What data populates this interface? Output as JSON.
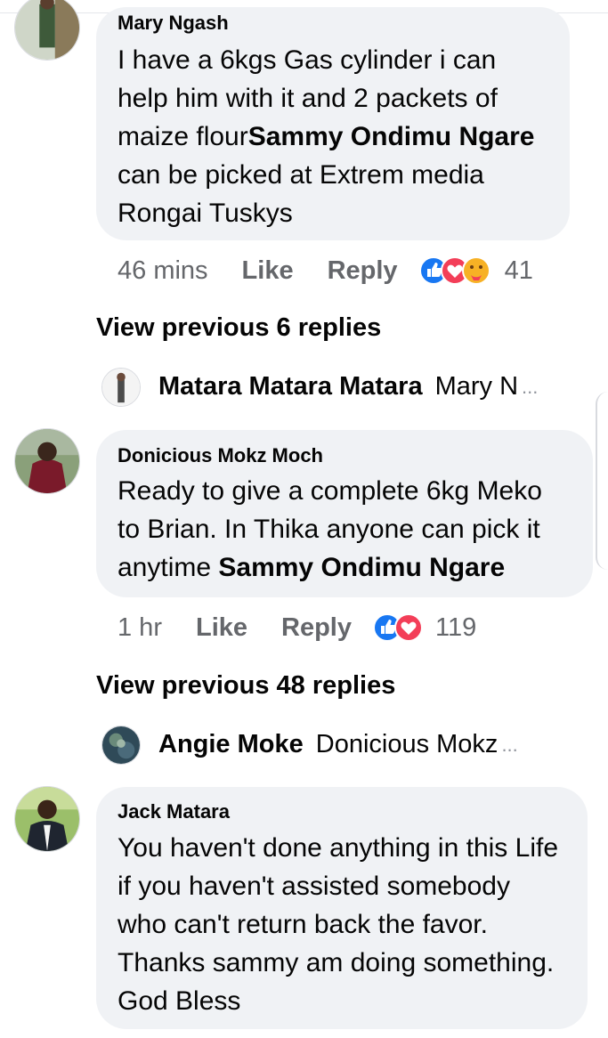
{
  "comments": [
    {
      "author": "Mary Ngash",
      "text_before": "I have a 6kgs Gas cylinder i can help him with it and 2 packets of maize flour",
      "mention": "Sammy Ondimu Ngare",
      "text_after": " can be picked at Extrem media Rongai Tuskys",
      "time": "46 mins",
      "like_label": "Like",
      "reply_label": "Reply",
      "reaction_icons": [
        "like-reaction",
        "love-reaction",
        "care-reaction"
      ],
      "reaction_count": "41"
    },
    {
      "author": "Donicious Mokz Moch",
      "text_before": "Ready to give  a complete 6kg Meko to Brian. In Thika anyone can pick it anytime ",
      "mention": "Sammy Ondimu Ngare",
      "text_after": "",
      "time": "1 hr",
      "like_label": "Like",
      "reply_label": "Reply",
      "reaction_icons": [
        "like-reaction",
        "love-reaction"
      ],
      "reaction_count": "119"
    },
    {
      "author": "Jack Matara",
      "text_before": "You haven't done anything in this Life if you haven't assisted somebody who can't return back the favor. Thanks sammy am doing something. God Bless",
      "mention": "",
      "text_after": ""
    }
  ],
  "view_previous": [
    {
      "label": "View previous 6 replies"
    },
    {
      "label": "View previous 48 replies"
    }
  ],
  "reply_previews": [
    {
      "name": "Matara Matara Matara",
      "snippet": "Mary N",
      "ellipsis": "..."
    },
    {
      "name": "Angie Moke",
      "snippet": "Donicious Mokz",
      "ellipsis": "..."
    }
  ],
  "colors": {
    "bubble": "#f0f2f5",
    "text": "#050505",
    "meta": "#65676b",
    "like_blue": "#1877f2",
    "love_red": "#f33e58",
    "care_yellow": "#f7b125"
  }
}
